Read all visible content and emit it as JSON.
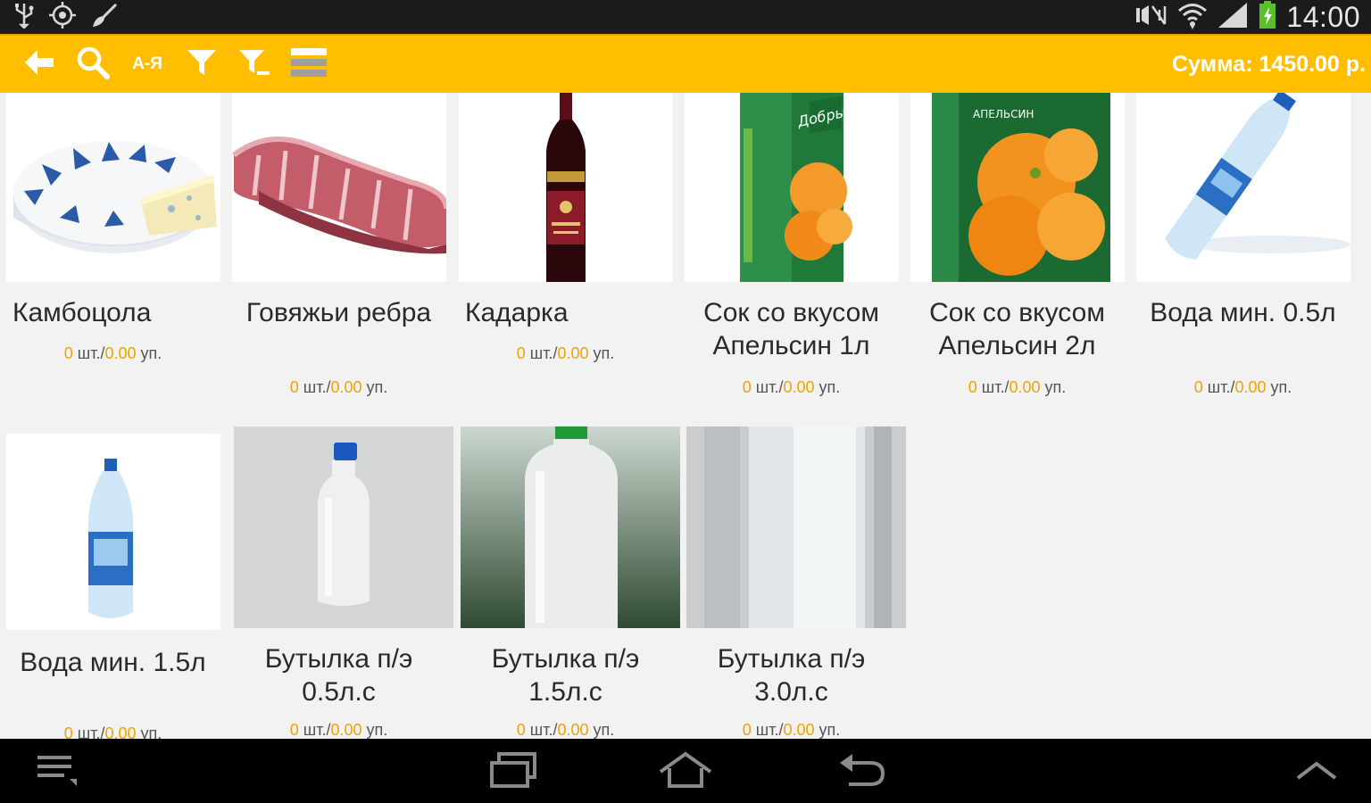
{
  "status_bar": {
    "time": "14:00",
    "left_icons": [
      "usb-icon",
      "gps-icon",
      "broom-icon"
    ],
    "right_icons": [
      "mute-icon",
      "wifi-icon",
      "signal-icon",
      "battery-icon"
    ]
  },
  "action_bar": {
    "sort_label": "А-Я",
    "sum_text": "Сумма: 1450.00 р.",
    "accent_color": "#ffbf00",
    "icons": [
      "back-arrow-icon",
      "search-icon",
      "sort-az-icon",
      "filter-icon",
      "filter-clear-icon",
      "menu-lines-icon"
    ]
  },
  "products": [
    {
      "name": "Камбоцола",
      "qty_count": "0",
      "qty_unit1": " шт./",
      "qty_value": "0.00",
      "qty_unit2": " уп."
    },
    {
      "name": "Говяжьи ребра",
      "qty_count": "0",
      "qty_unit1": " шт./",
      "qty_value": "0.00",
      "qty_unit2": " уп."
    },
    {
      "name": "Кадарка",
      "qty_count": "0",
      "qty_unit1": " шт./",
      "qty_value": "0.00",
      "qty_unit2": " уп."
    },
    {
      "name": "Сок со вкусом Апельсин 1л",
      "qty_count": "0",
      "qty_unit1": " шт./",
      "qty_value": "0.00",
      "qty_unit2": " уп."
    },
    {
      "name": "Сок со вкусом Апельсин 2л",
      "qty_count": "0",
      "qty_unit1": " шт./",
      "qty_value": "0.00",
      "qty_unit2": " уп."
    },
    {
      "name": "Вода мин. 0.5л",
      "qty_count": "0",
      "qty_unit1": " шт./",
      "qty_value": "0.00",
      "qty_unit2": " уп."
    },
    {
      "name": "Вода мин. 1.5л",
      "qty_count": "0",
      "qty_unit1": " шт./",
      "qty_value": "0.00",
      "qty_unit2": " уп."
    },
    {
      "name": "Бутылка п/э 0.5л.с",
      "qty_count": "0",
      "qty_unit1": " шт./",
      "qty_value": "0.00",
      "qty_unit2": " уп."
    },
    {
      "name": "Бутылка п/э 1.5л.с",
      "qty_count": "0",
      "qty_unit1": " шт./",
      "qty_value": "0.00",
      "qty_unit2": " уп."
    },
    {
      "name": "Бутылка п/э 3.0л.с",
      "qty_count": "0",
      "qty_unit1": " шт./",
      "qty_value": "0.00",
      "qty_unit2": " уп."
    }
  ],
  "nav_bar": {
    "icons": [
      "menu-icon",
      "recent-apps-icon",
      "home-icon",
      "back-icon",
      "chevron-up-icon"
    ]
  }
}
